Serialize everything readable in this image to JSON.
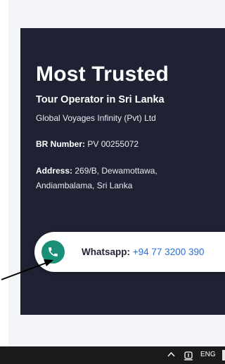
{
  "card": {
    "headline": "Most Trusted",
    "subheading": "Tour Operator in Sri Lanka",
    "company": "Global Voyages Infinity (Pvt) Ltd",
    "br_label": "BR Number:",
    "br_value": "PV 00255072",
    "address_label": "Address:",
    "address_value": "269/B, Dewamottawa, Andiambalama, Sri Lanka"
  },
  "whatsapp": {
    "label": "Whatsapp:",
    "number": "+94 77 3200 390",
    "icon": "phone-icon",
    "icon_color": "#1a8f78"
  },
  "taskbar": {
    "language": "ENG"
  },
  "colors": {
    "card_background": "#1f2233",
    "link_blue": "#2a6fd6"
  }
}
